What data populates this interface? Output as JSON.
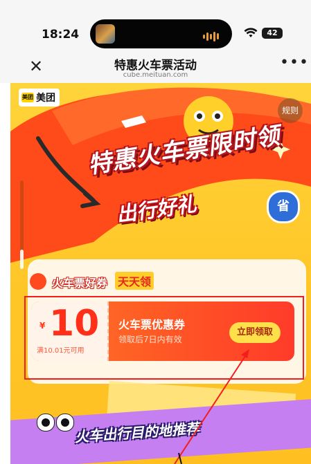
{
  "status_bar": {
    "time": "18:24",
    "battery": "42"
  },
  "nav": {
    "title": "特惠火车票活动",
    "url": "cube.meituan.com",
    "close_glyph": "✕",
    "more_glyph": "•••"
  },
  "brand": {
    "logo_mark": "美团",
    "logo_text": "美团",
    "color": "#ffd100"
  },
  "hero": {
    "title": "特惠火车票限时领",
    "subtitle": "出行好礼",
    "badge": "省",
    "rules_label": "规则"
  },
  "coupon_section": {
    "title_prefix": "火车票好券",
    "title_accent": "天天领",
    "coupon": {
      "currency": "¥",
      "amount": "10",
      "condition": "满10.01元可用",
      "name": "火车票优惠券",
      "validity": "领取后7日内有效",
      "claim_label": "立即领取"
    }
  },
  "bottom_banner": {
    "title": "火车出行目的地推荐"
  },
  "colors": {
    "accent_red": "#ff3b2a",
    "highlight_border": "#f21d1d",
    "bg_yellow": "#ffc729",
    "purple": "#c67ff0"
  }
}
